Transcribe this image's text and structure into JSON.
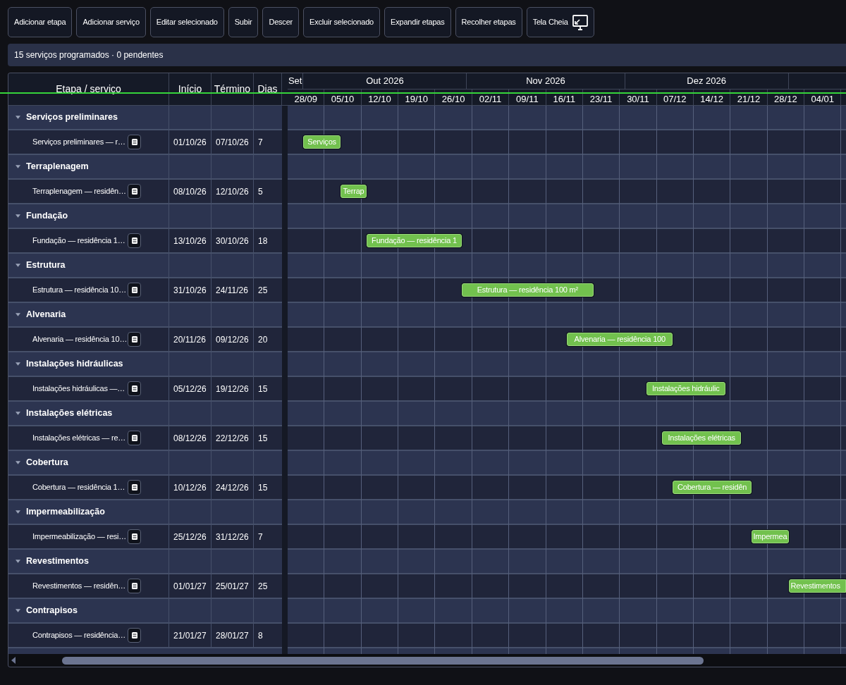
{
  "toolbar": {
    "buttons": [
      {
        "label": "Adicionar etapa",
        "kind": "text"
      },
      {
        "label": "Adicionar serviço",
        "kind": "text"
      },
      {
        "label": "Editar selecionado",
        "kind": "text"
      },
      {
        "label": "Subir",
        "kind": "text"
      },
      {
        "label": "Descer",
        "kind": "text"
      },
      {
        "label": "Excluir selecionado",
        "kind": "text"
      },
      {
        "label": "Expandir etapas",
        "kind": "text"
      },
      {
        "label": "Recolher etapas",
        "kind": "text"
      },
      {
        "label": "Tela Cheia",
        "kind": "fullscreen"
      }
    ]
  },
  "status_bar": {
    "text": "15 serviços programados · 0 pendentes"
  },
  "table": {
    "columns": [
      "Etapa / serviço",
      "Início",
      "Término",
      "Dias"
    ]
  },
  "timeline": {
    "months": [
      "Set",
      "Out 2026",
      "Nov 2026",
      "Dez 2026"
    ],
    "weeks": [
      "28/09",
      "05/10",
      "12/10",
      "19/10",
      "26/10",
      "02/11",
      "09/11",
      "16/11",
      "23/11",
      "30/11",
      "07/12",
      "14/12",
      "21/12",
      "28/12",
      "04/01"
    ]
  },
  "stages": [
    {
      "name": "Serviços preliminares",
      "expanded": true,
      "services": [
        {
          "name": "Serviços preliminares — r…",
          "start": "01/10/26",
          "end": "07/10/26",
          "days": "7",
          "bar_label": "Serviços"
        }
      ]
    },
    {
      "name": "Terraplenagem",
      "expanded": true,
      "services": [
        {
          "name": "Terraplenagem — residên…",
          "start": "08/10/26",
          "end": "12/10/26",
          "days": "5",
          "bar_label": "Terrap"
        }
      ]
    },
    {
      "name": "Fundação",
      "expanded": true,
      "services": [
        {
          "name": "Fundação — residência 1…",
          "start": "13/10/26",
          "end": "30/10/26",
          "days": "18",
          "bar_label": "Fundação — residência 1"
        }
      ]
    },
    {
      "name": "Estrutura",
      "expanded": true,
      "services": [
        {
          "name": "Estrutura — residência 10…",
          "start": "31/10/26",
          "end": "24/11/26",
          "days": "25",
          "bar_label": "Estrutura — residência 100 m²"
        }
      ]
    },
    {
      "name": "Alvenaria",
      "expanded": true,
      "services": [
        {
          "name": "Alvenaria — residência 10…",
          "start": "20/11/26",
          "end": "09/12/26",
          "days": "20",
          "bar_label": "Alvenaria — residência 100"
        }
      ]
    },
    {
      "name": "Instalações hidráulicas",
      "expanded": true,
      "services": [
        {
          "name": "Instalações hidráulicas —…",
          "start": "05/12/26",
          "end": "19/12/26",
          "days": "15",
          "bar_label": "Instalações hidráulic"
        }
      ]
    },
    {
      "name": "Instalações elétricas",
      "expanded": true,
      "services": [
        {
          "name": "Instalações elétricas — re…",
          "start": "08/12/26",
          "end": "22/12/26",
          "days": "15",
          "bar_label": "Instalações elétricas"
        }
      ]
    },
    {
      "name": "Cobertura",
      "expanded": true,
      "services": [
        {
          "name": "Cobertura — residência 1…",
          "start": "10/12/26",
          "end": "24/12/26",
          "days": "15",
          "bar_label": "Cobertura — residên"
        }
      ]
    },
    {
      "name": "Impermeabilização",
      "expanded": true,
      "services": [
        {
          "name": "Impermeabilização — resi…",
          "start": "25/12/26",
          "end": "31/12/26",
          "days": "7",
          "bar_label": "Impermea"
        }
      ]
    },
    {
      "name": "Revestimentos",
      "expanded": true,
      "services": [
        {
          "name": "Revestimentos — residên…",
          "start": "01/01/27",
          "end": "25/01/27",
          "days": "25",
          "bar_label": "Revestimentos"
        }
      ]
    },
    {
      "name": "Contrapisos",
      "expanded": true,
      "services": [
        {
          "name": "Contrapisos — residência…",
          "start": "21/01/27",
          "end": "28/01/27",
          "days": "8"
        }
      ]
    }
  ]
}
